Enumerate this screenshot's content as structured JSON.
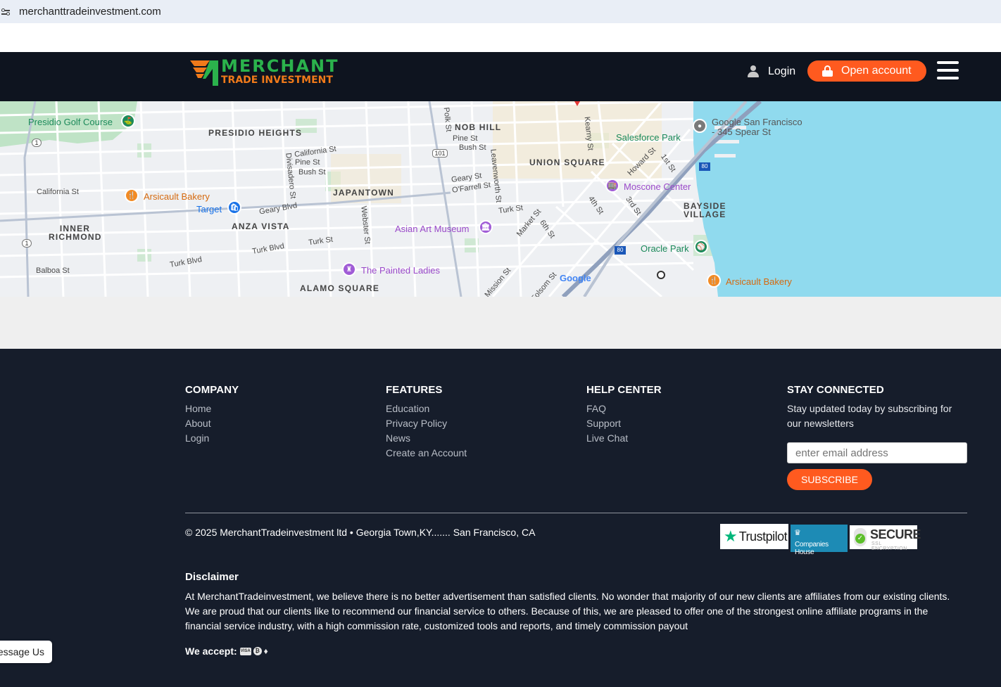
{
  "browser": {
    "url": "merchanttradeinvestment.com"
  },
  "header": {
    "logo_line1": "MERCHANT",
    "logo_line2": "TRADE INVESTMENT",
    "login_label": "Login",
    "open_account_label": "Open account"
  },
  "map": {
    "neighborhoods": [
      "PRESIDIO HEIGHTS",
      "NOB HILL",
      "UNION SQUARE",
      "JAPANTOWN",
      "ANZA VISTA",
      "INNER RICHMOND",
      "BAYSIDE VILLAGE",
      "ALAMO SQUARE"
    ],
    "streets": [
      "California St",
      "Pine St",
      "Bush St",
      "Geary Blvd",
      "Turk St",
      "Turk Blvd",
      "Balboa St",
      "Divisadero St",
      "Webster St",
      "Polk St",
      "Leavenworth St",
      "Geary St",
      "O'Farrell St",
      "Kearny St",
      "Howard St",
      "1st St",
      "4th St",
      "3rd St",
      "Market St",
      "6th St",
      "Mission St",
      "Folsom St"
    ],
    "pois": {
      "presidio_golf": "Presidio Golf Course",
      "arsicault_1": "Arsicault Bakery",
      "target": "Target",
      "asian_art": "Asian Art Museum",
      "painted_ladies": "The Painted Ladies",
      "google_sf_1": "Google San Francisco",
      "google_sf_2": "- 345 Spear St",
      "salesforce_park": "Salesforce Park",
      "moscone": "Moscone Center",
      "oracle_park": "Oracle Park",
      "arsicault_2": "Arsicault Bakery"
    },
    "google_logo": "Google",
    "highways": [
      "1",
      "1",
      "101",
      "80",
      "80"
    ]
  },
  "footer": {
    "company": {
      "title": "COMPANY",
      "links": [
        "Home",
        "About",
        "Login"
      ]
    },
    "features": {
      "title": "FEATURES",
      "links": [
        "Education",
        "Privacy Policy",
        "News",
        "Create an Account"
      ]
    },
    "help": {
      "title": "HELP CENTER",
      "links": [
        "FAQ",
        "Support",
        "Live Chat"
      ]
    },
    "stay": {
      "title": "STAY CONNECTED",
      "text": "Stay updated today by subscribing for our newsletters",
      "email_placeholder": "enter email address",
      "subscribe_label": "SUBSCRIBE"
    },
    "copyright": "© 2025 MerchantTradeinvestment ltd • Georgia Town,KY....... San Francisco, CA",
    "badges": {
      "trustpilot": "Trustpilot",
      "companies_house": "Companies House",
      "secure": "SECURE",
      "secure_sub": "SSL ENCRYPTION"
    },
    "disclaimer_title": "Disclaimer",
    "disclaimer_text": "At MerchantTradeinvestment, we believe there is no better advertisement than satisfied clients. No wonder that majority of our new clients are affiliates from our existing clients. We are proud that our clients like to recommend our financial service to others. Because of this, we are pleased to offer one of the strongest online affiliate programs in the financial service industry, with a high commission rate, customized tools and reports, and timely commission payout",
    "we_accept": "We accept:",
    "payment_icons": [
      "visa-icon",
      "bitcoin-icon",
      "ethereum-icon"
    ]
  },
  "chat": {
    "label": "Message Us"
  },
  "colors": {
    "accent": "#ff5a1f",
    "brand_green": "#2bb24c",
    "brand_orange": "#f07a1a",
    "footer_bg": "#161d2b",
    "header_bg": "#0e141f",
    "water": "#90daee"
  }
}
